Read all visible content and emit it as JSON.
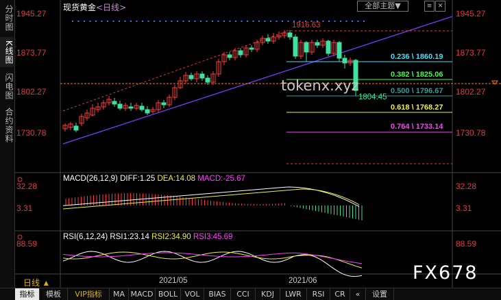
{
  "sidebar": {
    "tabs": [
      {
        "label": "分时图",
        "active": false
      },
      {
        "label": "K线图",
        "active": true
      },
      {
        "label": "闪电图",
        "active": false
      },
      {
        "label": "合约资料",
        "active": false
      }
    ]
  },
  "header": {
    "title": "现货黄金",
    "subtitle": "<日线>",
    "theme_button": "全部主题",
    "dropdown_glyph": "▼",
    "menu_glyph": "≡",
    "close_glyph": "✕"
  },
  "price_axis": {
    "left": [
      "1945.27",
      "1873.77",
      "1802.27",
      "1730.78"
    ],
    "right": [
      "1945.27",
      "1873.77",
      "1802.27",
      "1730.78"
    ]
  },
  "annotations": {
    "high": "1916.63",
    "low": "1804.45"
  },
  "fib_levels": [
    {
      "label": "0.236 \\ 1860.19",
      "color": "#40e0ff"
    },
    {
      "label": "0.382 \\ 1825.06",
      "color": "#40ff40"
    },
    {
      "label": "0.500 \\ 1796.67",
      "color": "#2f9c9c"
    },
    {
      "label": "0.618 \\ 1768.27",
      "color": "#f0f040"
    },
    {
      "label": "0.764 \\ 1733.14",
      "color": "#ff40ff"
    }
  ],
  "macd": {
    "name": "MACD(26,12,9)",
    "diff": "DIFF:1.25",
    "dea": "DEA:14.08",
    "macd": "MACD:-25.67",
    "axis": [
      "32.28",
      "3.31"
    ]
  },
  "rsi": {
    "name": "RSI(6,12,24)",
    "rsi1": "RSI1:23.14",
    "rsi2": "RSI2:34.90",
    "rsi3": "RSI3:45.69",
    "axis": [
      "88.59"
    ]
  },
  "dates": [
    "2021/05",
    "2021/06"
  ],
  "period_label": "日线",
  "bottom_tabs": [
    "指标",
    "模板",
    "VIP指标",
    "MA",
    "MACD",
    "BOLL",
    "VOL",
    "BIAS",
    "CCI",
    "KDJ",
    "LWR",
    "RSI",
    "CR",
    "设置"
  ],
  "watermarks": [
    "tokenx.xyz",
    "FX678"
  ],
  "colors": {
    "up": "#ff3c3c",
    "down": "#40e0a0",
    "axis": "#e03c3c",
    "channel": "#7b3cff"
  }
}
